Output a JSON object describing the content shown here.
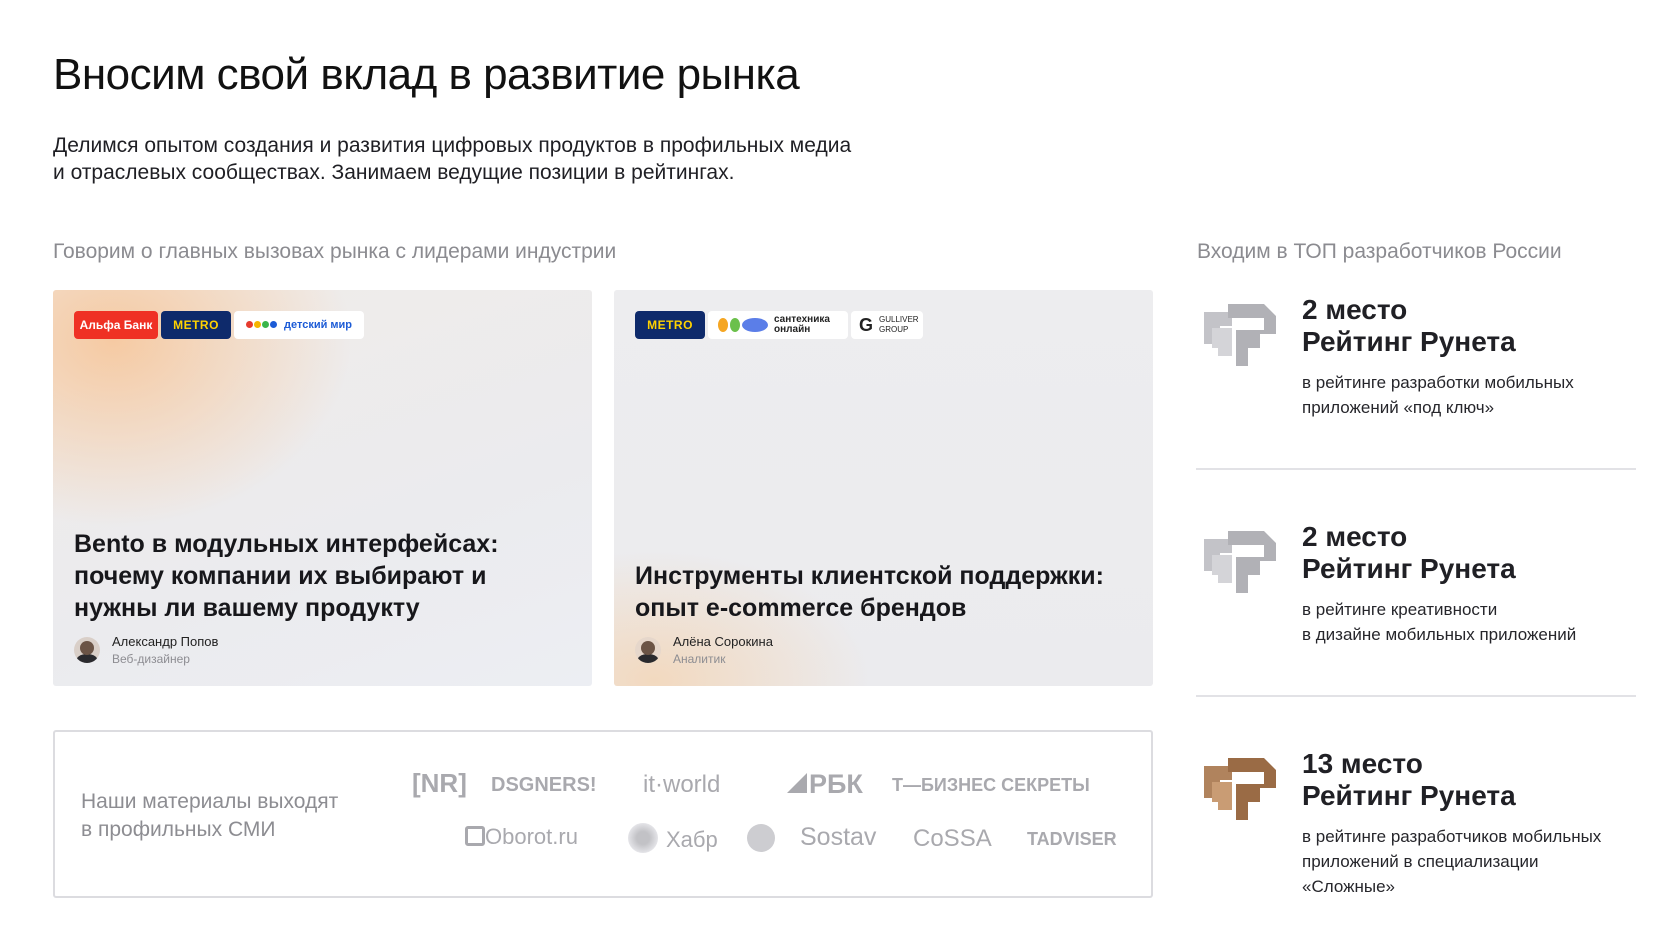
{
  "header": {
    "title": "Вносим свой вклад в развитие рынка",
    "intro_line1": "Делимся опытом создания и развития цифровых продуктов в профильных медиа",
    "intro_line2": "и отраслевых сообществах. Занимаем ведущие позиции в рейтингах."
  },
  "talks": {
    "label": "Говорим о главных вызовах рынка с лидерами индустрии",
    "cards": [
      {
        "logos": [
          "Альфа Банк",
          "METRO",
          "детский мир"
        ],
        "title": "Bento в модульных интерфейсах: почему компании их выбирают и нужны ли вашему продукту",
        "author_name": "Александр Попов",
        "author_role": "Веб-дизайнер"
      },
      {
        "logos": [
          "METRO",
          "сантехника онлайн",
          "GULLIVER GROUP"
        ],
        "title": "Инструменты клиентской поддержки: опыт e-commerce брендов",
        "author_name": "Алёна Сорокина",
        "author_role": "Аналитик"
      }
    ]
  },
  "media": {
    "label_line1": "Наши материалы выходят",
    "label_line2": "в профильных СМИ",
    "logos": [
      "[NR]",
      "DSGNERS!",
      "it·world",
      "РБК",
      "Т—БИЗНЕС СЕКРЕТЫ",
      "Oborot.ru",
      "Хабр",
      "Sostav",
      "CoSSA",
      "TADVISER"
    ]
  },
  "ratings": {
    "label": "Входим в ТОП разработчиков России",
    "items": [
      {
        "place": "2 место",
        "name": "Рейтинг Рунета",
        "desc_line1": "в рейтинге разработки мобильных",
        "desc_line2": "приложений «под ключ»",
        "desc_line3": "",
        "icon": "ruward-silver-icon"
      },
      {
        "place": "2 место",
        "name": "Рейтинг Рунета",
        "desc_line1": "в рейтинге креативности",
        "desc_line2": "в дизайне мобильных приложений",
        "desc_line3": "",
        "icon": "ruward-silver-icon"
      },
      {
        "place": "13 место",
        "name": "Рейтинг Рунета",
        "desc_line1": "в рейтинге разработчиков мобильных",
        "desc_line2": "приложений в специализации",
        "desc_line3": "«Сложные»",
        "icon": "ruward-bronze-icon"
      }
    ]
  },
  "colors": {
    "silver": "#b9b9be",
    "bronze": "#a0724e",
    "alfa_red": "#ef3124",
    "metro_navy": "#0e2a6b",
    "metro_yellow": "#ffd200"
  }
}
